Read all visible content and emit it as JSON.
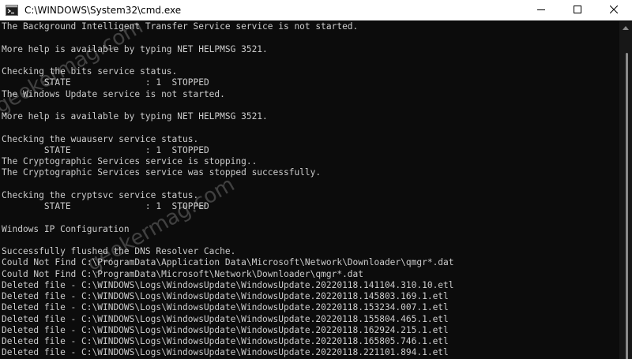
{
  "window": {
    "title": "C:\\WINDOWS\\System32\\cmd.exe",
    "icon": "cmd-icon",
    "controls": {
      "minimize_icon": "minimize-icon",
      "maximize_icon": "maximize-icon",
      "close_icon": "close-icon"
    }
  },
  "console": {
    "lines": [
      "The Background Intelligent Transfer Service service is not started.",
      "",
      "More help is available by typing NET HELPMSG 3521.",
      "",
      "Checking the bits service status.",
      "        STATE              : 1  STOPPED",
      "The Windows Update service is not started.",
      "",
      "More help is available by typing NET HELPMSG 3521.",
      "",
      "Checking the wuauserv service status.",
      "        STATE              : 1  STOPPED",
      "The Cryptographic Services service is stopping..",
      "The Cryptographic Services service was stopped successfully.",
      "",
      "Checking the cryptsvc service status.",
      "        STATE              : 1  STOPPED",
      "",
      "Windows IP Configuration",
      "",
      "Successfully flushed the DNS Resolver Cache.",
      "Could Not Find C:\\ProgramData\\Application Data\\Microsoft\\Network\\Downloader\\qmgr*.dat",
      "Could Not Find C:\\ProgramData\\Microsoft\\Network\\Downloader\\qmgr*.dat",
      "Deleted file - C:\\WINDOWS\\Logs\\WindowsUpdate\\WindowsUpdate.20220118.141104.310.10.etl",
      "Deleted file - C:\\WINDOWS\\Logs\\WindowsUpdate\\WindowsUpdate.20220118.145803.169.1.etl",
      "Deleted file - C:\\WINDOWS\\Logs\\WindowsUpdate\\WindowsUpdate.20220118.153234.007.1.etl",
      "Deleted file - C:\\WINDOWS\\Logs\\WindowsUpdate\\WindowsUpdate.20220118.155804.465.1.etl",
      "Deleted file - C:\\WINDOWS\\Logs\\WindowsUpdate\\WindowsUpdate.20220118.162924.215.1.etl",
      "Deleted file - C:\\WINDOWS\\Logs\\WindowsUpdate\\WindowsUpdate.20220118.165805.746.1.etl",
      "Deleted file - C:\\WINDOWS\\Logs\\WindowsUpdate\\WindowsUpdate.20220118.221101.894.1.etl"
    ]
  },
  "watermark": {
    "text": "geekermag.com"
  }
}
